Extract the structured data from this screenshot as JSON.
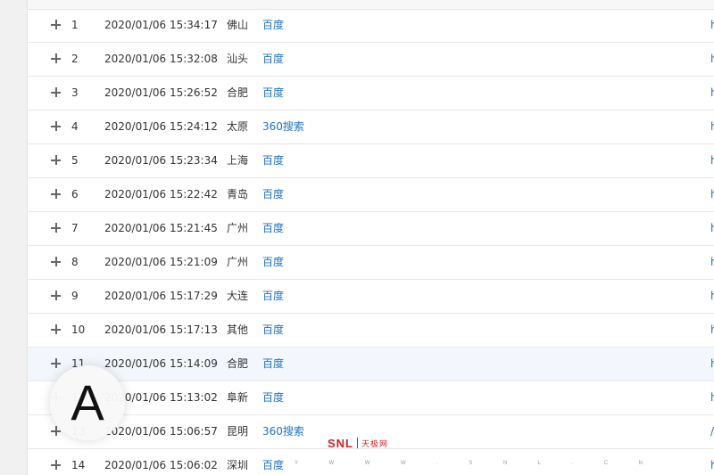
{
  "rows": [
    {
      "index": "1",
      "time": "2020/01/06 15:34:17",
      "city": "佛山",
      "source": "百度",
      "link": "h"
    },
    {
      "index": "2",
      "time": "2020/01/06 15:32:08",
      "city": "汕头",
      "source": "百度",
      "link": "h"
    },
    {
      "index": "3",
      "time": "2020/01/06 15:26:52",
      "city": "合肥",
      "source": "百度",
      "link": "h"
    },
    {
      "index": "4",
      "time": "2020/01/06 15:24:12",
      "city": "太原",
      "source": "360搜索",
      "link": "h"
    },
    {
      "index": "5",
      "time": "2020/01/06 15:23:34",
      "city": "上海",
      "source": "百度",
      "link": "h"
    },
    {
      "index": "6",
      "time": "2020/01/06 15:22:42",
      "city": "青岛",
      "source": "百度",
      "link": "h"
    },
    {
      "index": "7",
      "time": "2020/01/06 15:21:45",
      "city": "广州",
      "source": "百度",
      "link": "h"
    },
    {
      "index": "8",
      "time": "2020/01/06 15:21:09",
      "city": "广州",
      "source": "百度",
      "link": "h"
    },
    {
      "index": "9",
      "time": "2020/01/06 15:17:29",
      "city": "大连",
      "source": "百度",
      "link": "h"
    },
    {
      "index": "10",
      "time": "2020/01/06 15:17:13",
      "city": "其他",
      "source": "百度",
      "link": "h"
    },
    {
      "index": "11",
      "time": "2020/01/06 15:14:09",
      "city": "合肥",
      "source": "百度",
      "link": "h"
    },
    {
      "index": "12",
      "time": "2020/01/06 15:13:02",
      "city": "阜新",
      "source": "百度",
      "link": "h"
    },
    {
      "index": "13",
      "time": "2020/01/06 15:06:57",
      "city": "昆明",
      "source": "360搜索",
      "link": "/"
    },
    {
      "index": "14",
      "time": "2020/01/06 15:06:02",
      "city": "深圳",
      "source": "百度",
      "link": "h"
    }
  ],
  "highlighted_row_index": "11",
  "overlay_letter": "A",
  "watermark": {
    "logo": "SNL",
    "text": "天极网",
    "url_chars": [
      "Y",
      "W",
      "W",
      "W",
      ".",
      "S",
      "N",
      "L",
      ".",
      "C",
      "N"
    ]
  },
  "colors": {
    "link": "#1f73c2",
    "text": "#333333",
    "highlight_row": "#f3f7fd",
    "watermark": "#d61f1f"
  }
}
